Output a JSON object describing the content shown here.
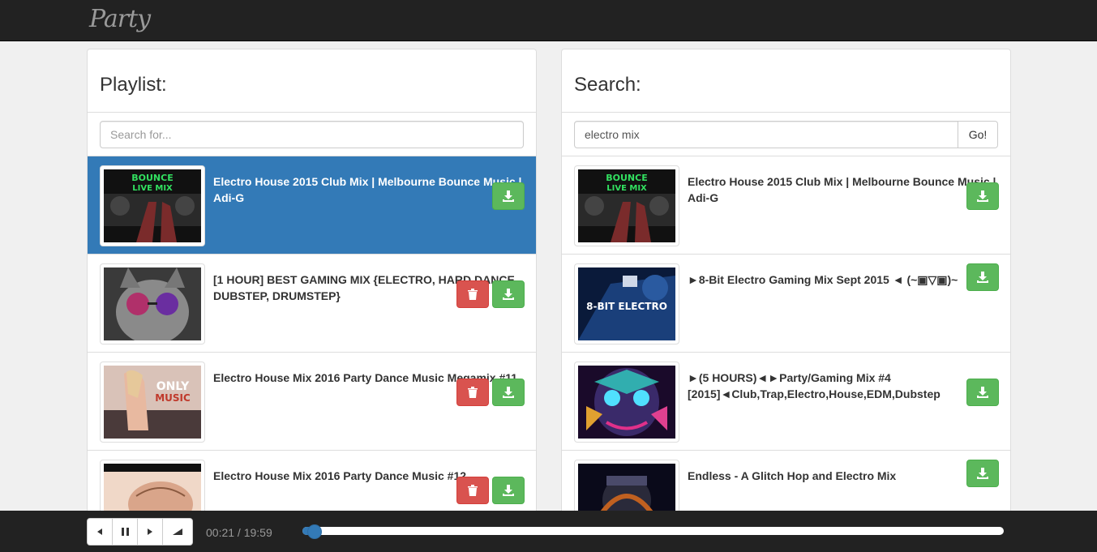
{
  "app": {
    "brand": "Party"
  },
  "playlist": {
    "title": "Playlist:",
    "search_placeholder": "Search for...",
    "items": [
      {
        "title": "Electro House 2015 Club Mix | Melbourne Bounce Music | Adi-G",
        "active": true,
        "deletable": false,
        "thumb": "bounce-live-mix"
      },
      {
        "title": "[1 HOUR] BEST GAMING MIX {ELECTRO, HARD DANCE, DUBSTEP, DRUMSTEP}",
        "active": false,
        "deletable": true,
        "thumb": "cat-glasses"
      },
      {
        "title": "Electro House Mix 2016 Party Dance Music Megamix #11",
        "active": false,
        "deletable": true,
        "thumb": "only-music"
      },
      {
        "title": "Electro House Mix 2016 Party Dance Music #12",
        "active": false,
        "deletable": true,
        "thumb": "only-beach"
      }
    ]
  },
  "search": {
    "title": "Search:",
    "query": "electro mix",
    "go_label": "Go!",
    "results": [
      {
        "title": "Electro House 2015 Club Mix | Melbourne Bounce Music | Adi-G",
        "thumb": "bounce-live-mix"
      },
      {
        "title": "►8-Bit Electro Gaming Mix Sept 2015 ◄ (~▣▽▣)~",
        "thumb": "8bit-electro"
      },
      {
        "title": "►(5 HOURS)◄►Party/Gaming Mix #4 [2015]◄Club,Trap,Electro,House,EDM,Dubstep",
        "thumb": "neon-face"
      },
      {
        "title": "Endless - A Glitch Hop and Electro Mix",
        "thumb": "robot-dj"
      }
    ]
  },
  "player": {
    "time": "00:21 / 19:59",
    "progress_fraction": 0.0175,
    "controls": [
      "prev-icon",
      "pause-icon",
      "next-icon",
      "volume-icon"
    ]
  },
  "colors": {
    "accent": "#337ab7",
    "success": "#5cb85c",
    "danger": "#d9534f",
    "navbar": "#222222"
  }
}
